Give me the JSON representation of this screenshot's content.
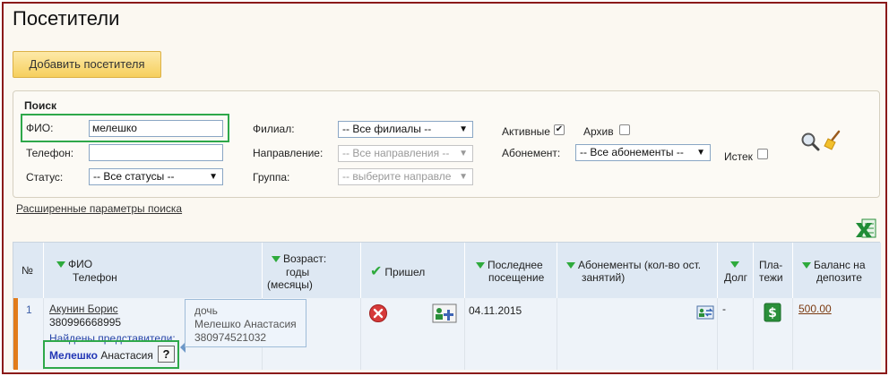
{
  "page": {
    "title": "Посетители"
  },
  "toolbar": {
    "add_label": "Добавить посетителя"
  },
  "search": {
    "title": "Поиск",
    "fio_label": "ФИО:",
    "fio_value": "мелешко",
    "phone_label": "Телефон:",
    "phone_value": "",
    "status_label": "Статус:",
    "status_value": "-- Все статусы --",
    "branch_label": "Филиал:",
    "branch_value": "-- Все филиалы --",
    "direction_label": "Направление:",
    "direction_value": "-- Все направления --",
    "group_label": "Группа:",
    "group_value": "-- выберите направле",
    "active_label": "Активные",
    "active_checked": true,
    "archive_label": "Архив",
    "archive_checked": false,
    "subscription_label": "Абонемент:",
    "subscription_value": "-- Все абонементы --",
    "expired_label": "Истек",
    "expired_checked": false,
    "advanced_link": "Расширенные параметры поиска"
  },
  "table": {
    "headers": {
      "num": "№",
      "fio": "ФИО",
      "phone": "Телефон",
      "age_1": "Возраст:",
      "age_2": "годы",
      "age_3": "(месяцы)",
      "came": "Пришел",
      "last_visit_1": "Последнее",
      "last_visit_2": "посещение",
      "subs_1": "Абонементы (кол-во ост.",
      "subs_2": "занятий)",
      "debt": "Долг",
      "payments_1": "Пла-",
      "payments_2": "тежи",
      "balance_1": "Баланс на",
      "balance_2": "депозите"
    },
    "row": {
      "num": "1",
      "name": "Акунин Борис",
      "phone": "380996668995",
      "reps_label": "Найдены представители:",
      "rep_last": "Мелешко",
      "rep_first": "Анастасия",
      "rep_q": "?",
      "last_visit": "04.11.2015",
      "debt": "-",
      "balance": "500.00"
    }
  },
  "tooltip": {
    "relation": "дочь",
    "name": "Мелешко Анастасия",
    "phone": "380974521032"
  },
  "colors": {
    "accent_green": "#2ea84a",
    "header_blue": "#dee8f3",
    "frame_red": "#8b1a1a"
  }
}
